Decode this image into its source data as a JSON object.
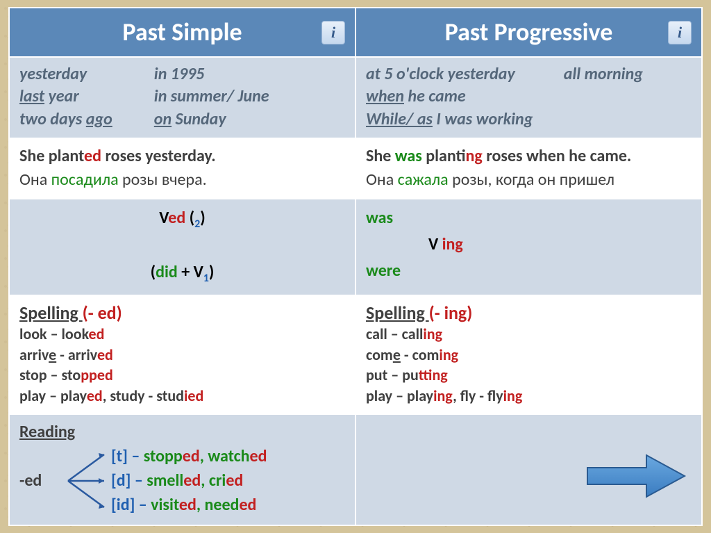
{
  "headers": {
    "pastSimple": "Past Simple",
    "pastProgressive": "Past Progressive"
  },
  "markers": {
    "ps": {
      "c1a": "yesterday",
      "c1b_pre": "last",
      "c1b_post": " year",
      "c1c_pre": "two days ",
      "c1c_post": "ago",
      "c2a": "in 1995",
      "c2b": "in summer/ June",
      "c2c_pre": "on",
      "c2c_post": " Sunday"
    },
    "pp": {
      "r1a": "at 5 o'clock  yesterday",
      "r1b": "all morning",
      "r2_pre": "when",
      "r2_post": " he came",
      "r3_pre": "While/ as",
      "r3_post": " I was working"
    }
  },
  "examples": {
    "ps_en_pre": "She  plant",
    "ps_en_ed": "ed",
    "ps_en_post": " roses yesterday.",
    "ps_ru_pre": "Она ",
    "ps_ru_verb": "посадила",
    "ps_ru_post": " розы вчера.",
    "pp_en_1": "She ",
    "pp_en_was": "was",
    "pp_en_2": " plant",
    "pp_en_ing": "ing",
    "pp_en_3": " roses when he came.",
    "pp_ru_pre": "Она ",
    "pp_ru_verb": "сажала",
    "pp_ru_post": " розы, когда он пришел"
  },
  "forms": {
    "ps_v": "V",
    "ps_ed": "ed",
    "ps_paren_open": " (",
    "ps_2": "2",
    "ps_paren_close": ")",
    "ps_neg_open": "(",
    "ps_did": "did",
    "ps_plus": " + V",
    "ps_1": "1",
    "ps_neg_close": ")",
    "pp_was": "was",
    "pp_v": "V ",
    "pp_ing": "ing",
    "pp_were": "were"
  },
  "spelling": {
    "ps_title_a": "Spelling  ",
    "ps_title_b": "(- ed)",
    "ps_l1_a": "look – look",
    "ps_l1_b": "ed",
    "ps_l2_a": "arriv",
    "ps_l2_u": "e",
    "ps_l2_b": " - arriv",
    "ps_l2_c": "ed",
    "ps_l3_a": "stop – sto",
    "ps_l3_b": "pp",
    "ps_l3_c": "ed",
    "ps_l4_a": "play – play",
    "ps_l4_b": "ed",
    "ps_l4_c": ", study - stud",
    "ps_l4_d": "ied",
    "pp_title_a": "Spelling  ",
    "pp_title_b": "(- ing)",
    "pp_l1_a": "call – call",
    "pp_l1_b": "ing",
    "pp_l2_a": "com",
    "pp_l2_u": "e",
    "pp_l2_b": " - com",
    "pp_l2_c": "ing",
    "pp_l3_a": "put – pu",
    "pp_l3_b": "tt",
    "pp_l3_c": "ing",
    "pp_l4_a": "play – play",
    "pp_l4_b": "ing",
    "pp_l4_c": ", fly - fly",
    "pp_l4_d": "ing"
  },
  "reading": {
    "title": "Reading",
    "ed": "-ed",
    "t_a": "[t] – ",
    "t_b": "stopp",
    "t_c": "ed",
    "t_d": ", watch",
    "t_e": "ed",
    "d_a": "[d] – ",
    "d_b": "smell",
    "d_c": "ed",
    "d_d": ", cri",
    "d_e": "ed",
    "id_a": "[id] – ",
    "id_b": "visit",
    "id_c": "ed",
    "id_d": ", need",
    "id_e": "ed"
  }
}
